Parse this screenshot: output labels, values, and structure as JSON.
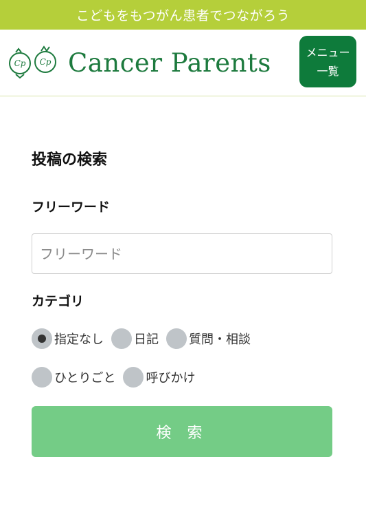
{
  "site": {
    "tagline": "こどもをもつがん患者でつながろう",
    "logo_text": "Cancer Parents",
    "logo_mark": "Cp"
  },
  "header": {
    "menu_line1": "メニュー",
    "menu_line2": "一覧"
  },
  "search": {
    "title": "投稿の検索",
    "freeword_label": "フリーワード",
    "freeword_placeholder": "フリーワード",
    "freeword_value": "",
    "category_label": "カテゴリ",
    "categories_row1": [
      {
        "label": "指定なし",
        "selected": true
      },
      {
        "label": "日記",
        "selected": false
      },
      {
        "label": "質問・相談",
        "selected": false
      }
    ],
    "categories_row2": [
      {
        "label": "ひとりごと",
        "selected": false
      },
      {
        "label": "呼びかけ",
        "selected": false
      }
    ],
    "submit_label": "検 索"
  },
  "colors": {
    "top_bar": "#b5cf3a",
    "brand_green": "#0e7b3b",
    "logo_green": "#1d7a3e",
    "submit_green": "#74cc86",
    "radio_gray": "#bfc4c8"
  }
}
